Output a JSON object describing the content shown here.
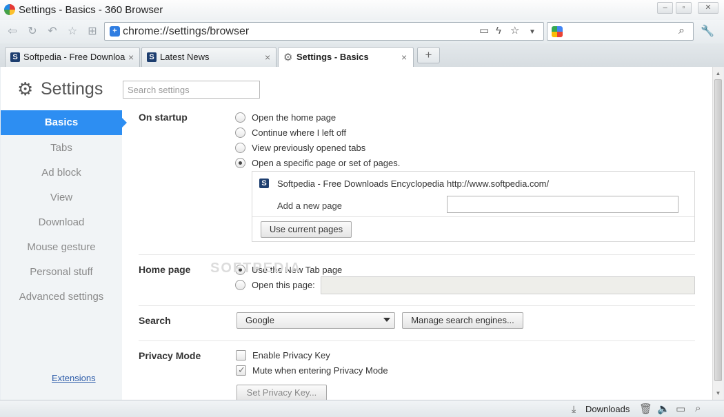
{
  "window": {
    "title": "Settings - Basics - 360 Browser"
  },
  "address_bar": {
    "url": "chrome://settings/browser"
  },
  "tabs": [
    {
      "label": "Softpedia - Free Downloa",
      "close": "×"
    },
    {
      "label": "Latest News",
      "close": "×"
    },
    {
      "label": "Settings - Basics",
      "close": "×"
    }
  ],
  "new_tab": "+",
  "settings": {
    "title": "Settings",
    "search_placeholder": "Search settings"
  },
  "sidebar": {
    "items": [
      "Basics",
      "Tabs",
      "Ad block",
      "View",
      "Download",
      "Mouse gesture",
      "Personal stuff",
      "Advanced settings"
    ],
    "extensions": "Extensions"
  },
  "startup": {
    "title": "On startup",
    "options": [
      "Open the home page",
      "Continue where I left off",
      "View previously opened tabs",
      "Open a specific page or set of pages."
    ],
    "page_title": "Softpedia - Free Downloads Encyclopedia",
    "page_url": "http://www.softpedia.com/",
    "add_page_label": "Add a new page",
    "use_current_button": "Use current pages"
  },
  "homepage": {
    "title": "Home page",
    "options": [
      "Use the New Tab page",
      "Open this page:"
    ]
  },
  "search": {
    "title": "Search",
    "engine": "Google",
    "manage_button": "Manage search engines..."
  },
  "privacy": {
    "title": "Privacy Mode",
    "options": [
      "Enable Privacy Key",
      "Mute when entering Privacy Mode"
    ],
    "set_key_button": "Set Privacy Key..."
  },
  "statusbar": {
    "downloads": "Downloads"
  },
  "watermark": "SOFTPEDIA"
}
